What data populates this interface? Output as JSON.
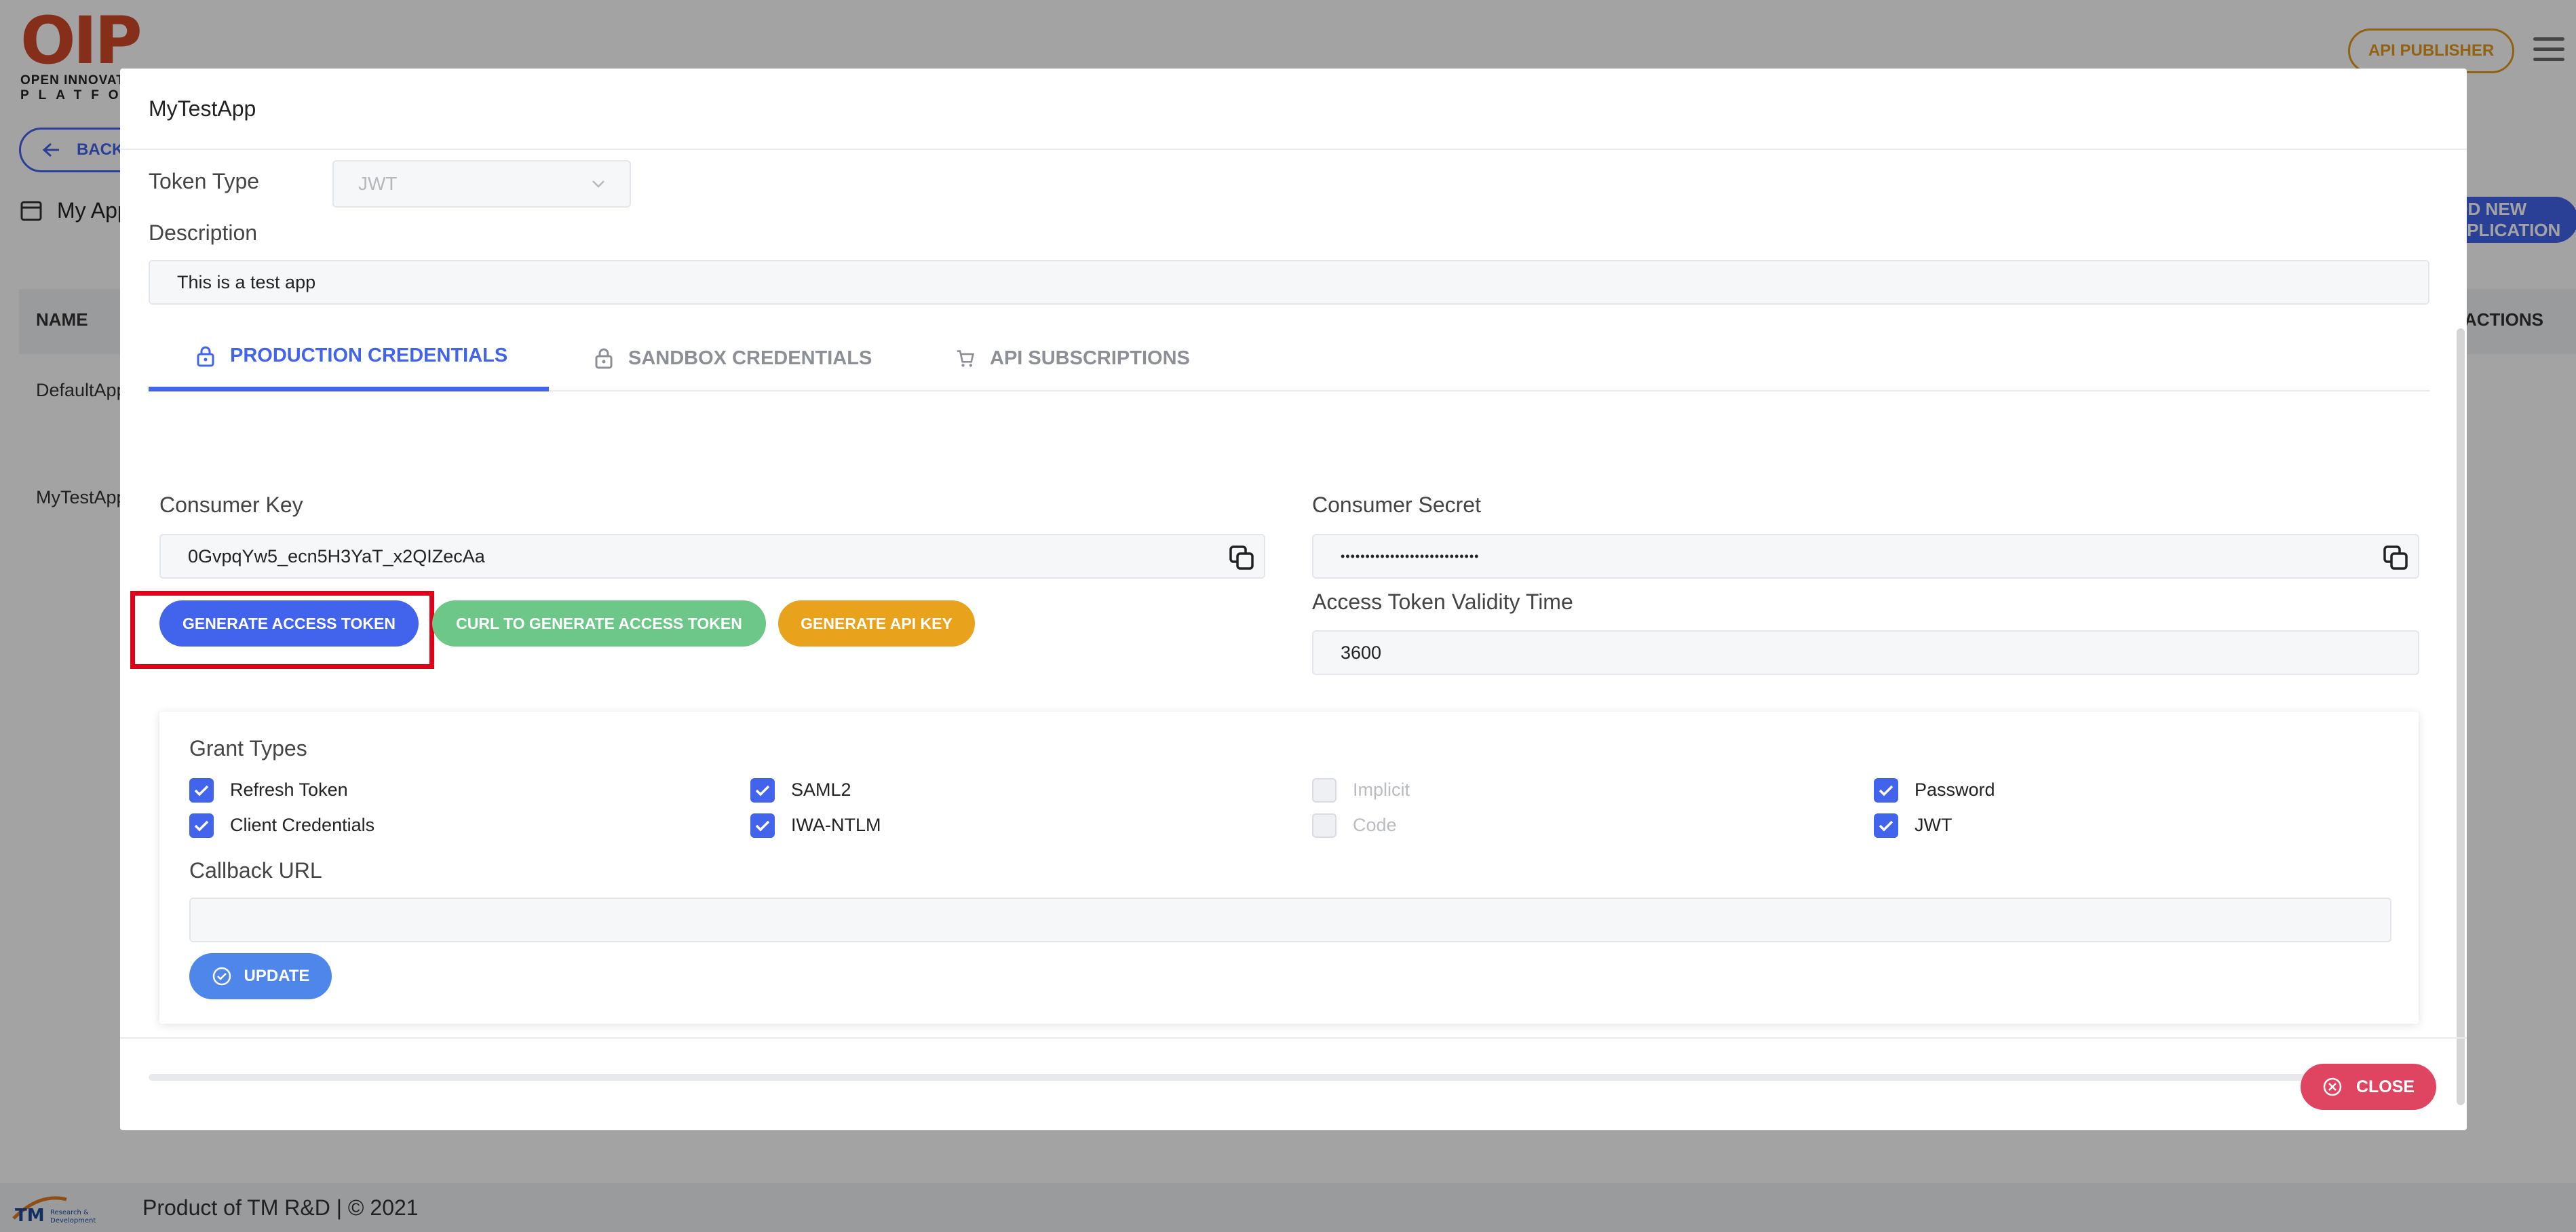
{
  "background": {
    "logo_text": "OIP",
    "logo_subtitle_1": "OPEN INNOVATION",
    "logo_subtitle_2": "PLATFORM",
    "publisher_button": "API PUBLISHER",
    "back_button": "BACK",
    "section_title": "My Applications",
    "add_button": "ADD NEW APPLICATION",
    "table": {
      "col_name": "NAME",
      "col_right": "ACTIONS",
      "rows": [
        "DefaultApplication",
        "MyTestApp"
      ]
    },
    "footer_text": "Product of TM R&D | © 2021",
    "footer_logo": "TM Research & Development"
  },
  "modal": {
    "title": "MyTestApp",
    "token_type_label": "Token Type",
    "token_type_value": "JWT",
    "description_label": "Description",
    "description_value": "This is a test app",
    "tabs": [
      {
        "label": "PRODUCTION CREDENTIALS",
        "icon": "lock-icon",
        "active": true
      },
      {
        "label": "SANDBOX CREDENTIALS",
        "icon": "lock-icon",
        "active": false
      },
      {
        "label": "API SUBSCRIPTIONS",
        "icon": "cart-icon",
        "active": false
      }
    ],
    "consumer_key_label": "Consumer Key",
    "consumer_key_value": "0GvpqYw5_ecn5H3YaT_x2QIZecAa",
    "consumer_secret_label": "Consumer Secret",
    "consumer_secret_value": "••••••••••••••••••••••••••••",
    "validity_label": "Access Token Validity Time",
    "validity_value": "3600",
    "buttons": {
      "generate_token": "GENERATE ACCESS TOKEN",
      "curl_token": "CURL TO GENERATE ACCESS TOKEN",
      "api_key": "GENERATE API KEY"
    },
    "grant_types_label": "Grant Types",
    "grant_types": [
      {
        "label": "Refresh Token",
        "checked": true,
        "disabled": false
      },
      {
        "label": "SAML2",
        "checked": true,
        "disabled": false
      },
      {
        "label": "Implicit",
        "checked": false,
        "disabled": true
      },
      {
        "label": "Password",
        "checked": true,
        "disabled": false
      },
      {
        "label": "Client Credentials",
        "checked": true,
        "disabled": false
      },
      {
        "label": "IWA-NTLM",
        "checked": true,
        "disabled": false
      },
      {
        "label": "Code",
        "checked": false,
        "disabled": true
      },
      {
        "label": "JWT",
        "checked": true,
        "disabled": false
      }
    ],
    "callback_label": "Callback URL",
    "callback_value": "",
    "update_button": "UPDATE",
    "close_button": "CLOSE"
  },
  "colors": {
    "primary": "#4263eb",
    "success": "#6cc788",
    "warning": "#e8a21c",
    "danger": "#df4561",
    "highlight": "#e1001a"
  }
}
